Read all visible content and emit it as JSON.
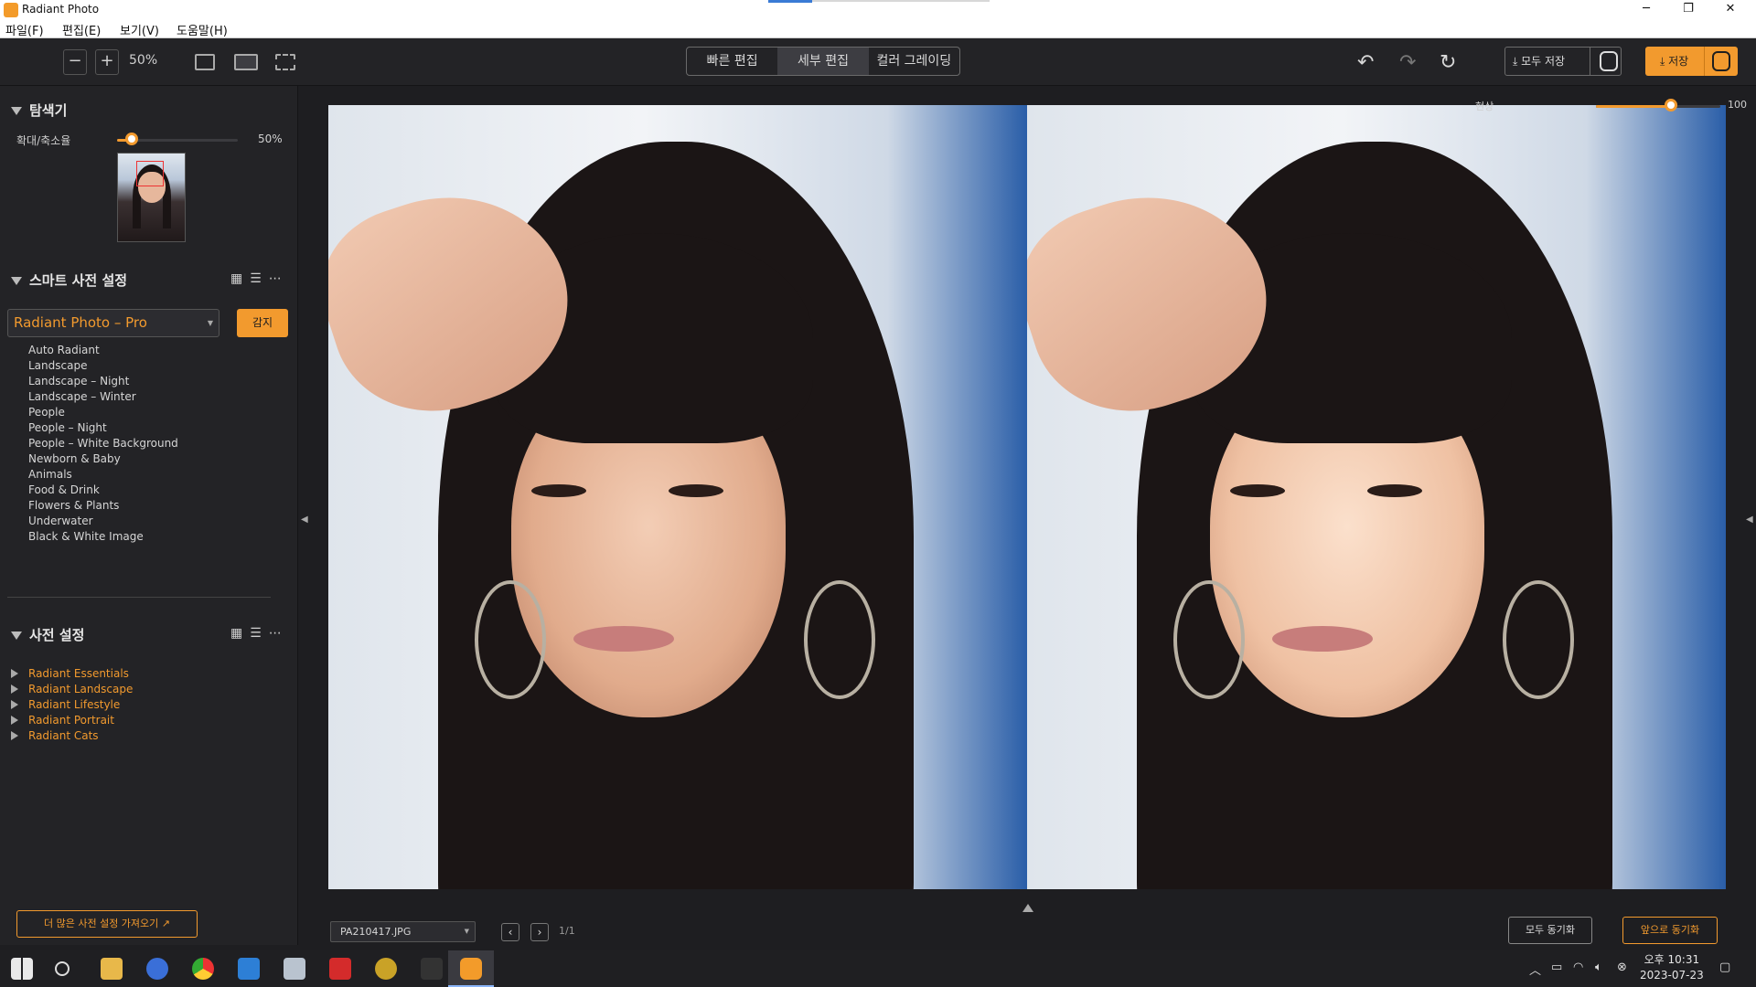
{
  "window": {
    "title": "Radiant Photo",
    "minimize": "─",
    "maximize": "❐",
    "close": "✕"
  },
  "menu": [
    "파일(F)",
    "편집(E)",
    "보기(V)",
    "도움말(H)"
  ],
  "toolbar": {
    "zoom_out": "−",
    "zoom_in": "+",
    "zoom_value": "50%",
    "modes": [
      "빠른 편집",
      "세부 편집",
      "컬러 그레이딩"
    ],
    "active_mode": 1,
    "undo": "↶",
    "redo": "↷",
    "reset": "↻",
    "save_all_label": "⤓ 모두 저장",
    "save_label": "⤓ 저장"
  },
  "navigator": {
    "title": "탐색기",
    "zoom_label": "확대/축소율",
    "zoom_value": "50%",
    "zoom_fraction": 0.5
  },
  "smart_presets": {
    "title": "스마트 사전 설정",
    "selected": "Radiant Photo – Pro",
    "apply_label": "감지",
    "items": [
      "Auto Radiant",
      "Landscape",
      "Landscape – Night",
      "Landscape – Winter",
      "People",
      "People – Night",
      "People – White Background",
      "Newborn & Baby",
      "Animals",
      "Food & Drink",
      "Flowers & Plants",
      "Underwater",
      "Black & White Image"
    ]
  },
  "presets": {
    "title": "사전 설정",
    "groups": [
      "Radiant Essentials",
      "Radiant Landscape",
      "Radiant Lifestyle",
      "Radiant Portrait",
      "Radiant Cats"
    ],
    "more_label": "더 많은 사전 설정 가져오기"
  },
  "compare": {
    "after_label": "현상",
    "strength_value": "100",
    "strength_fraction": 0.6
  },
  "footer": {
    "file_name": "PA210417.JPG",
    "prev": "‹",
    "next": "›",
    "page_count": "1/1",
    "sync_all": "모두 동기화",
    "sync_front": "앞으로 동기화"
  },
  "taskbar": {
    "time": "오후 10:31",
    "date": "2023-07-23"
  },
  "colors": {
    "accent": "#f29a2e",
    "bg": "#1e1e21",
    "panel": "#232326"
  }
}
